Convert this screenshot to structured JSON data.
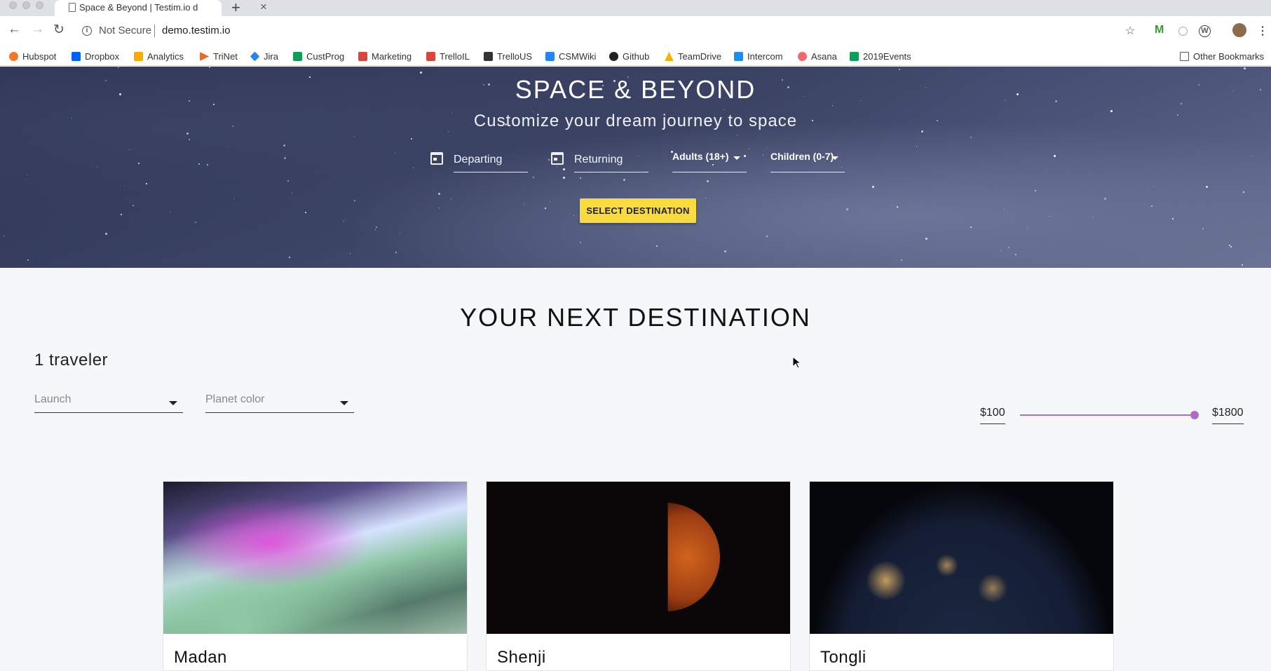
{
  "browser": {
    "tab_title": "Space & Beyond | Testim.io de",
    "security_label": "Not Secure",
    "url": "demo.testim.io",
    "bookmarks": [
      {
        "label": "Hubspot",
        "color": "#f57722"
      },
      {
        "label": "Dropbox",
        "color": "#0061fe"
      },
      {
        "label": "Analytics",
        "color": "#f9ab00"
      },
      {
        "label": "TriNet",
        "color": "#f26522"
      },
      {
        "label": "Jira",
        "color": "#2684ff"
      },
      {
        "label": "CustProg",
        "color": "#0f9d58"
      },
      {
        "label": "Marketing",
        "color": "#d9463b"
      },
      {
        "label": "TrelloIL",
        "color": "#d9463b"
      },
      {
        "label": "TrelloUS",
        "color": "#333333"
      },
      {
        "label": "CSMWiki",
        "color": "#2684ff"
      },
      {
        "label": "Github",
        "color": "#222222"
      },
      {
        "label": "TeamDrive",
        "color": "#f4b400"
      },
      {
        "label": "Intercom",
        "color": "#1f8ded"
      },
      {
        "label": "Asana",
        "color": "#f06a6a"
      },
      {
        "label": "2019Events",
        "color": "#0f9d58"
      }
    ],
    "other_bookmarks": "Other Bookmarks"
  },
  "hero": {
    "title": "SPACE & BEYOND",
    "subtitle": "Customize your dream journey to space",
    "departing": "Departing",
    "returning": "Returning",
    "adults": "Adults (18+)",
    "children": "Children (0-7)",
    "select_button": "SELECT DESTINATION"
  },
  "main": {
    "section_title": "YOUR NEXT DESTINATION",
    "travelers": "1 traveler",
    "filters": {
      "launch_placeholder": "Launch",
      "planet_color_placeholder": "Planet color"
    },
    "price": {
      "min_label": "$100",
      "max_label": "$1800",
      "slider_value_fraction": 1.0
    },
    "cards": [
      {
        "name": "Madan"
      },
      {
        "name": "Shenji"
      },
      {
        "name": "Tongli"
      }
    ]
  },
  "colors": {
    "accent_button": "#fadb3f",
    "slider": "#b06ac7"
  }
}
